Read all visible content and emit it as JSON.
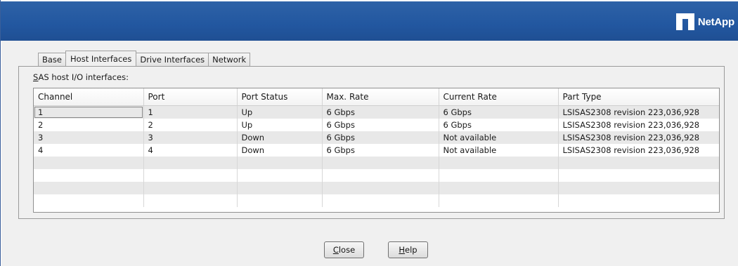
{
  "brand": {
    "logo_text": "NetApp",
    "logo_mark_icon": "netapp-logo-icon",
    "header_color": "#2257a0"
  },
  "tabs": [
    {
      "label": "Base",
      "active": false
    },
    {
      "label": "Host Interfaces",
      "active": true
    },
    {
      "label": "Drive Interfaces",
      "active": false
    },
    {
      "label": "Network",
      "active": false
    }
  ],
  "section": {
    "mnemonic": "S",
    "rest": "AS host I/O interfaces:"
  },
  "table": {
    "columns": [
      "Channel",
      "Port",
      "Port Status",
      "Max. Rate",
      "Current Rate",
      "Part Type"
    ],
    "rows": [
      [
        "1",
        "1",
        "Up",
        "6 Gbps",
        "6 Gbps",
        "LSISAS2308  revision 223,036,928"
      ],
      [
        "2",
        "2",
        "Up",
        "6 Gbps",
        "6 Gbps",
        "LSISAS2308  revision 223,036,928"
      ],
      [
        "3",
        "3",
        "Down",
        "6 Gbps",
        "Not available",
        "LSISAS2308  revision 223,036,928"
      ],
      [
        "4",
        "4",
        "Down",
        "6 Gbps",
        "Not available",
        "LSISAS2308  revision 223,036,928"
      ]
    ]
  },
  "buttons": {
    "close": {
      "mnemonic": "C",
      "rest": "lose"
    },
    "help": {
      "mnemonic": "H",
      "rest": "elp"
    }
  }
}
